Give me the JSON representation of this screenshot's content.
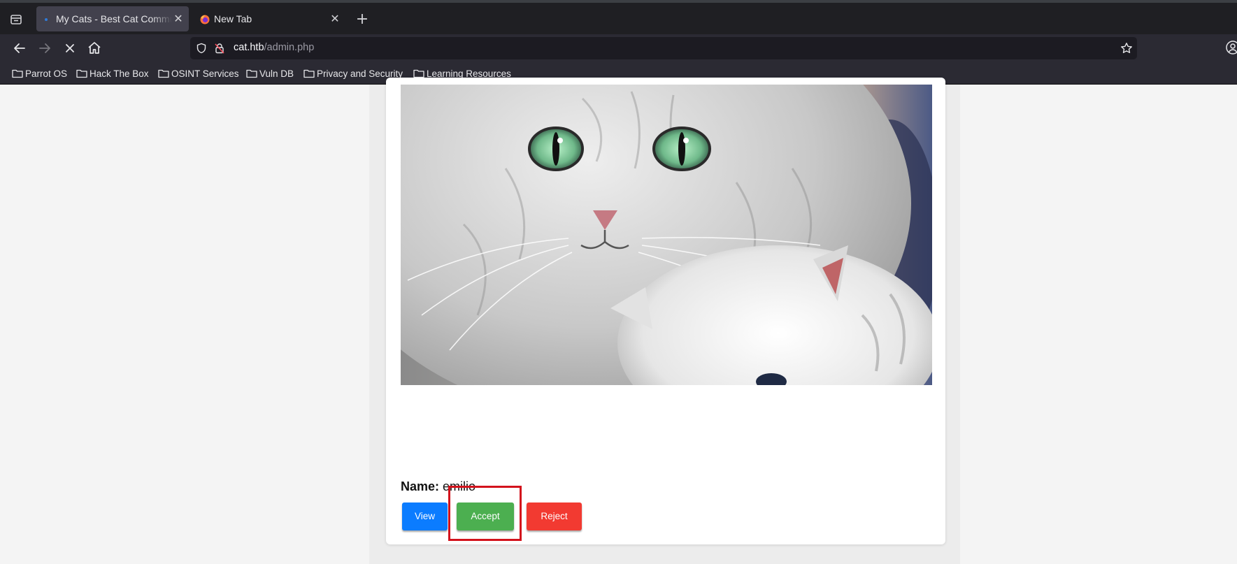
{
  "browser": {
    "tabs": [
      {
        "title": "My Cats - Best Cat Community",
        "active": true
      },
      {
        "title": "New Tab",
        "active": false
      }
    ],
    "url": {
      "host": "cat.htb",
      "path": "/admin.php"
    },
    "bookmarks": [
      {
        "label": "Parrot OS"
      },
      {
        "label": "Hack The Box"
      },
      {
        "label": "OSINT Services"
      },
      {
        "label": "Vuln DB"
      },
      {
        "label": "Privacy and Security"
      },
      {
        "label": "Learning Resources"
      }
    ]
  },
  "page": {
    "cat_entry": {
      "name_label": "Name:",
      "name_value": "emilio",
      "buttons": {
        "view": "View",
        "accept": "Accept",
        "reject": "Reject"
      }
    }
  },
  "colors": {
    "view_button": "#0b7cff",
    "accept_button": "#4caf50",
    "reject_button": "#f23a31",
    "highlight_box": "#d3121c"
  },
  "icons": {
    "tab_list": "tab-list-icon",
    "active_tab_favicon": "dot-favicon",
    "new_tab_favicon": "firefox-icon",
    "back": "back-arrow-icon",
    "forward": "forward-arrow-icon",
    "stop": "stop-loading-icon",
    "home": "home-icon",
    "tracking_protection": "shield-icon",
    "insecure_connection": "lock-slash-icon",
    "bookmark_star": "star-icon",
    "account": "account-icon",
    "bookmark_folder": "folder-icon"
  }
}
